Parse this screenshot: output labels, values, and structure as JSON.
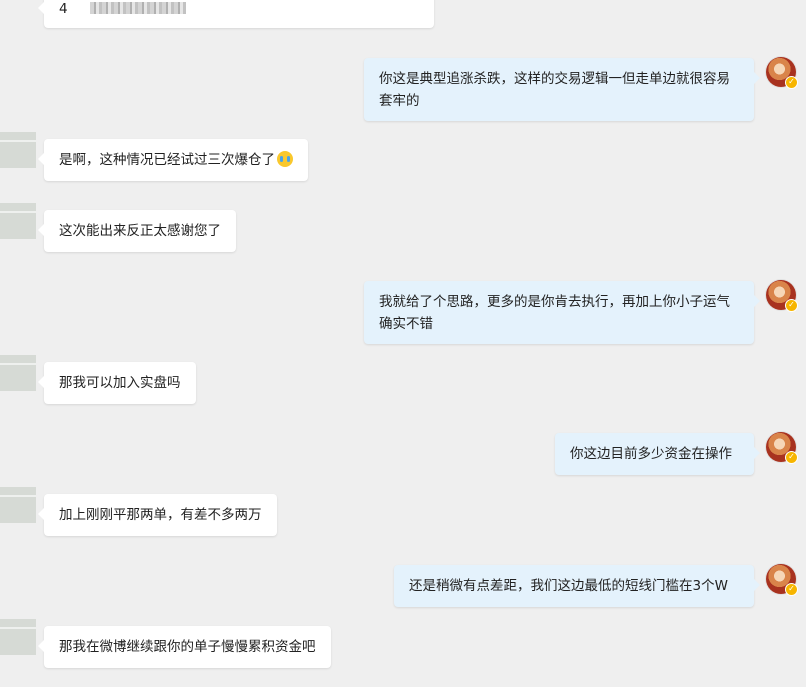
{
  "messages": [
    {
      "side": "left",
      "text": "4",
      "partial": true
    },
    {
      "side": "right",
      "text": "你这是典型追涨杀跌，这样的交易逻辑一但走单边就很容易套牢的"
    },
    {
      "side": "left",
      "text": "是啊，这种情况已经试过三次爆仓了",
      "emoji": "crying-face-emoji"
    },
    {
      "side": "left",
      "text": "这次能出来反正太感谢您了"
    },
    {
      "side": "right",
      "text": "我就给了个思路，更多的是你肯去执行，再加上你小子运气确实不错"
    },
    {
      "side": "left",
      "text": "那我可以加入实盘吗"
    },
    {
      "side": "right",
      "text": "你这边目前多少资金在操作"
    },
    {
      "side": "left",
      "text": "加上刚刚平那两单，有差不多两万"
    },
    {
      "side": "right",
      "text": "还是稍微有点差距，我们这边最低的短线门槛在3个W"
    },
    {
      "side": "left",
      "text": "那我在微博继续跟你的单子慢慢累积资金吧"
    }
  ],
  "colors": {
    "background": "#efefef",
    "left_bubble": "#ffffff",
    "right_bubble": "#e4f2fc",
    "verified_badge": "#f7b500"
  },
  "icons": {
    "verified_badge": "verified-badge-icon",
    "emoji": "crying-face-emoji"
  }
}
